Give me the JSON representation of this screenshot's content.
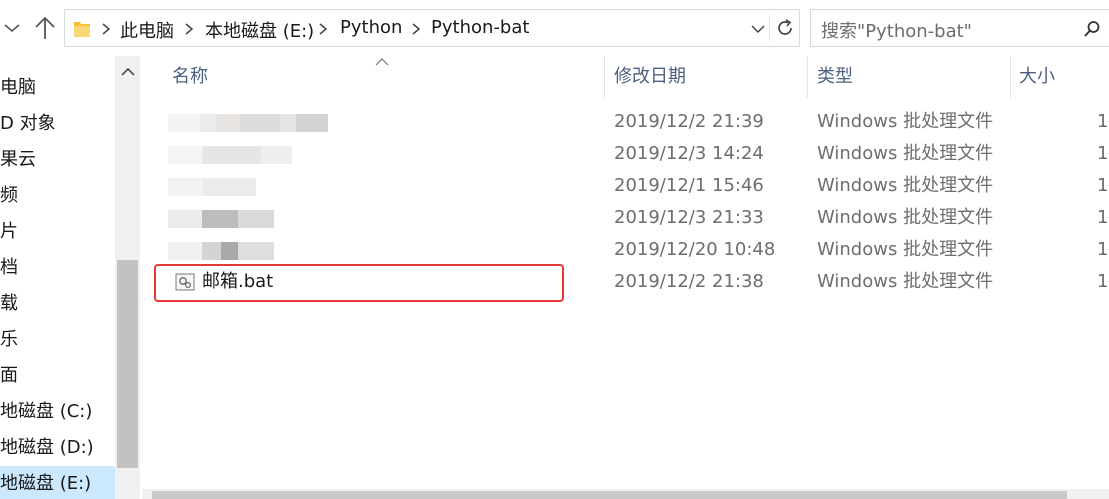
{
  "address": {
    "crumbs": [
      "此电脑",
      "本地磁盘 (E:)",
      "Python",
      "Python-bat"
    ]
  },
  "search": {
    "placeholder": "搜索\"Python-bat\""
  },
  "nav": {
    "items": [
      {
        "label": "电脑",
        "selected": false
      },
      {
        "label": "D 对象",
        "selected": false
      },
      {
        "label": "果云",
        "selected": false
      },
      {
        "label": "频",
        "selected": false
      },
      {
        "label": "片",
        "selected": false
      },
      {
        "label": "档",
        "selected": false
      },
      {
        "label": "载",
        "selected": false
      },
      {
        "label": "乐",
        "selected": false
      },
      {
        "label": "面",
        "selected": false
      },
      {
        "label": "地磁盘 (C:)",
        "selected": false
      },
      {
        "label": "地磁盘 (D:)",
        "selected": false
      },
      {
        "label": "地磁盘 (E:)",
        "selected": true
      }
    ]
  },
  "columns": {
    "name": "名称",
    "modified": "修改日期",
    "type": "类型",
    "size": "大小"
  },
  "files": [
    {
      "name": "",
      "modified": "2019/12/2 21:39",
      "type": "Windows 批处理文件",
      "size": "1",
      "blurred": true
    },
    {
      "name": "",
      "modified": "2019/12/3 14:24",
      "type": "Windows 批处理文件",
      "size": "1",
      "blurred": true
    },
    {
      "name": "",
      "modified": "2019/12/1 15:46",
      "type": "Windows 批处理文件",
      "size": "1",
      "blurred": true
    },
    {
      "name": "",
      "modified": "2019/12/3 21:33",
      "type": "Windows 批处理文件",
      "size": "1",
      "blurred": true
    },
    {
      "name": "",
      "modified": "2019/12/20 10:48",
      "type": "Windows 批处理文件",
      "size": "1",
      "blurred": true
    },
    {
      "name": "邮箱.bat",
      "modified": "2019/12/2 21:38",
      "type": "Windows 批处理文件",
      "size": "1",
      "blurred": false
    }
  ],
  "colors": {
    "header_text": "#4d6082",
    "highlight": "#e53935",
    "selected_bg": "#cce8ff",
    "folder": "#f4c430"
  }
}
